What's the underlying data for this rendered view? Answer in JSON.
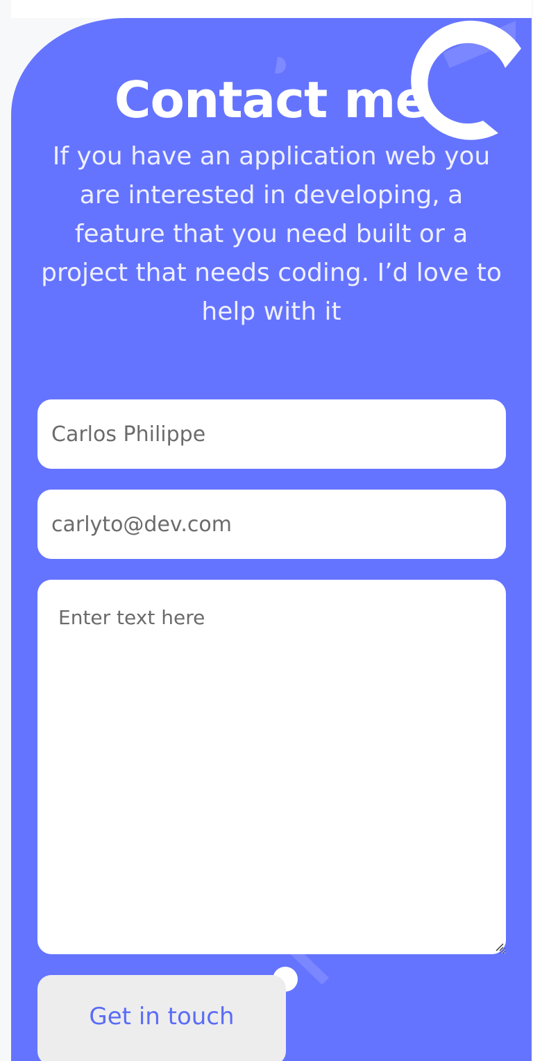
{
  "contact": {
    "title": "Contact me",
    "intro": "If you have an application web you are interested in developing, a feature that you need built or a project that needs coding. I’d love to help with it"
  },
  "form": {
    "name_value": "Carlos Philippe",
    "email_value": "carlyto@dev.com",
    "message_placeholder": "Enter text here",
    "submit_label": "Get in touch"
  },
  "colors": {
    "accent": "#6574ff",
    "button_bg": "#ededed",
    "button_text": "#5a6cf6",
    "field_bg": "#ffffff"
  }
}
